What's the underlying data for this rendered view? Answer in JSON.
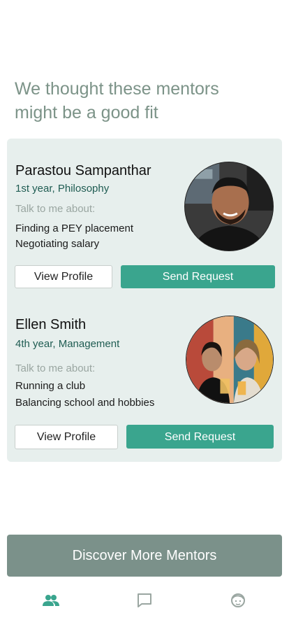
{
  "heading": "We thought these mentors might be a good fit",
  "mentors": [
    {
      "name": "Parastou Sampanthar",
      "year": "1st year, Philosophy",
      "talk_label": "Talk to me about:",
      "topics": [
        "Finding a PEY placement",
        "Negotiating salary"
      ],
      "view_label": "View Profile",
      "send_label": "Send Request"
    },
    {
      "name": "Ellen Smith",
      "year": "4th year, Management",
      "talk_label": "Talk to me about:",
      "topics": [
        "Running a club",
        "Balancing school and hobbies"
      ],
      "view_label": "View Profile",
      "send_label": "Send Request"
    }
  ],
  "discover_label": "Discover More Mentors",
  "tabs": [
    {
      "icon": "people-icon",
      "active": true
    },
    {
      "icon": "chat-icon",
      "active": false
    },
    {
      "icon": "face-icon",
      "active": false
    }
  ],
  "colors": {
    "accent": "#3aa58e",
    "heading": "#7c9388",
    "panel": "#e7efed",
    "discover": "#7b918a",
    "year_text": "#1f5c52"
  }
}
